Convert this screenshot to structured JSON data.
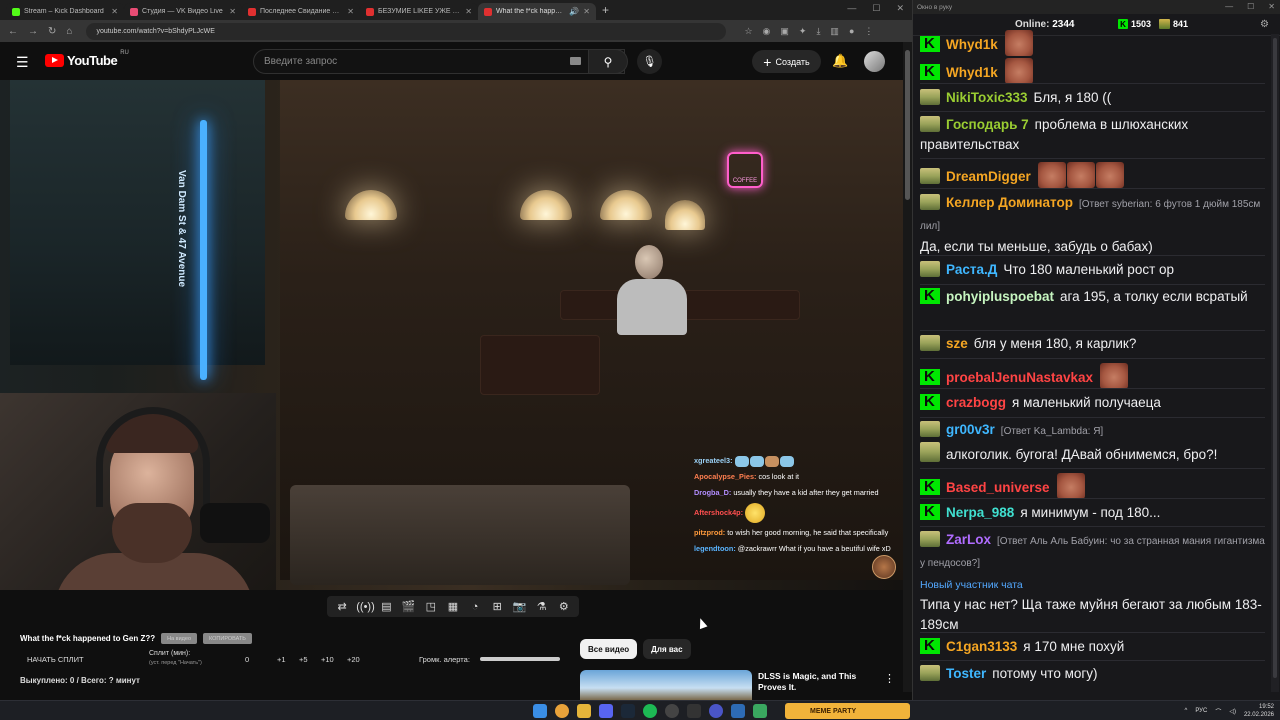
{
  "browser": {
    "tabs": [
      {
        "title": "Stream – Kick Dashboard",
        "color": "#53fc18",
        "active": false
      },
      {
        "title": "Студия — VK Видео Live",
        "color": "#e84c74",
        "active": false
      },
      {
        "title": "Последнее Свидание Яйцеслава",
        "color": "#e03030",
        "active": false
      },
      {
        "title": "БЕЗУМИЕ LIKEE УЖЕ НЕ ОСТАНОВИТЬ",
        "color": "#e03030",
        "active": false
      },
      {
        "title": "What the f*ck happened to Gen Z?",
        "color": "#e03030",
        "active": true
      }
    ],
    "url": "youtube.com/watch?v=bShdyPLJcWE"
  },
  "youtube": {
    "logo_text": "YouTube",
    "logo_region": "RU",
    "search_placeholder": "Введите запрос",
    "create_label": "Создать",
    "chips": [
      "Все видео",
      "Для вас"
    ],
    "rec_title": "DLSS is Magic, and This Proves It."
  },
  "video": {
    "neon_sign": "Van Dam St & 47 Avenue",
    "coffee_sign": "COFFEE"
  },
  "overlay_chat": [
    {
      "nick": "xgreateel3:",
      "text": "",
      "color": "#9ad0f5"
    },
    {
      "nick": "Apocalypse_Pies:",
      "text": "cos look at it",
      "color": "#ff7f50"
    },
    {
      "nick": "Drogba_D:",
      "text": "usually they have a kid after they get married",
      "color": "#b28dff"
    },
    {
      "nick": "Aftershock4p:",
      "text": "",
      "color": "#ff4f4f"
    },
    {
      "nick": "pitzprod:",
      "text": "to wish her good morning, he said that specifically",
      "color": "#ff9a3c"
    },
    {
      "nick": "legendtoon:",
      "text": "@zackrawrr What if you have a beutiful wife xD",
      "color": "#5ab4ff"
    }
  ],
  "stream_panel": {
    "title": "What the f*ck happened to Gen Z??",
    "btn1": "На видео",
    "btn2": "КОПИРОВАТЬ",
    "start_split": "НАЧАТЬ СПЛИТ",
    "split_min": "Сплит (мин):",
    "split_sub": "(уст. перед \"Начать\")",
    "split_values": [
      "0",
      "+1",
      "+5",
      "+10",
      "+20"
    ],
    "alert_volume": "Громк. алерта:",
    "bought": "Выкуплено: 0 / Всего: ? минут"
  },
  "chat": {
    "window_title": "Окно в руку",
    "online_label": "Online:",
    "online_count": "2344",
    "kick_count": "1503",
    "other_count": "841",
    "messages": [
      {
        "badge": "kick",
        "nick": "Whyd1k",
        "color": "#f5a623",
        "text": "",
        "emotes": 1
      },
      {
        "badge": "og",
        "nick": "NikiToxic333",
        "color": "#9acd32",
        "text": "Бля, я 180 ((",
        "emotes": 0
      },
      {
        "badge": "og",
        "nick": "Господарь 7",
        "color": "#9acd32",
        "text": "проблема в шлюханских правительствах",
        "emotes": 0
      },
      {
        "badge": "og",
        "nick": "DreamDigger",
        "color": "#f5a623",
        "text": "",
        "emotes": 3
      },
      {
        "badge": "og",
        "nick": "Келлер Доминатор",
        "color": "#f5a623",
        "reply": "[Ответ syberian: 6 футов 1 дюйм 185см лил]",
        "text": "Да, если ты меньше, забудь о бабах)",
        "emotes": 0
      },
      {
        "badge": "og",
        "nick": "Раста.Д",
        "color": "#3fb7ff",
        "text": "Что 180 маленький рост ор",
        "emotes": 0
      },
      {
        "badge": "kick",
        "nick": "pohyiplusрoebat",
        "color": "#c6f5c0",
        "text": "ага 195, а толку если всратый",
        "emotes": 0
      },
      {
        "badge": "og",
        "nick": "sze",
        "color": "#f5a623",
        "text": "бля у меня 180, я карлик?",
        "emotes": 0
      },
      {
        "badge": "kick",
        "nick": "proebalJenuNastavkax",
        "color": "#ff4444",
        "text": "",
        "emotes": 1
      },
      {
        "badge": "kick",
        "nick": "crazbogg",
        "color": "#ff4444",
        "text": "я маленький получаеца",
        "emotes": 0
      },
      {
        "badge": "og",
        "nick": "gr00v3r",
        "color": "#3fb7ff",
        "reply": "[Ответ Ka_Lambda: Я]",
        "text": "алкоголик. бугога! ДАвай обнимемся, бро?!",
        "emotes": 0
      },
      {
        "badge": "kick",
        "nick": "Based_universe",
        "color": "#ff4444",
        "text": "",
        "emotes": 1
      },
      {
        "badge": "kick",
        "nick": "Nerpa_988",
        "color": "#40e0d0",
        "text": "я минимум - под 180...",
        "emotes": 0
      },
      {
        "badge": "og",
        "nick": "ZarLox",
        "color": "#b06cff",
        "reply": "[Ответ Аль Аль Бабуин: чо за странная мания гигантизма у пендосов?]",
        "text": "",
        "emotes": 0
      },
      {
        "new_member": "Новый участник чата",
        "text": "Типа у нас нет? Ща таже муйня бегают за любым 183-189см"
      },
      {
        "badge": "kick",
        "nick": "C1gan3133",
        "color": "#f5a623",
        "text": "я 170 мне похуй",
        "emotes": 0
      },
      {
        "badge": "og",
        "nick": "Toster",
        "color": "#3fb7ff",
        "text": "потому что могу)",
        "emotes": 0
      }
    ]
  },
  "taskbar": {
    "promo": "MEME PARTY",
    "lang": "РУС",
    "time": "19:52",
    "date": "22.02.2026"
  }
}
